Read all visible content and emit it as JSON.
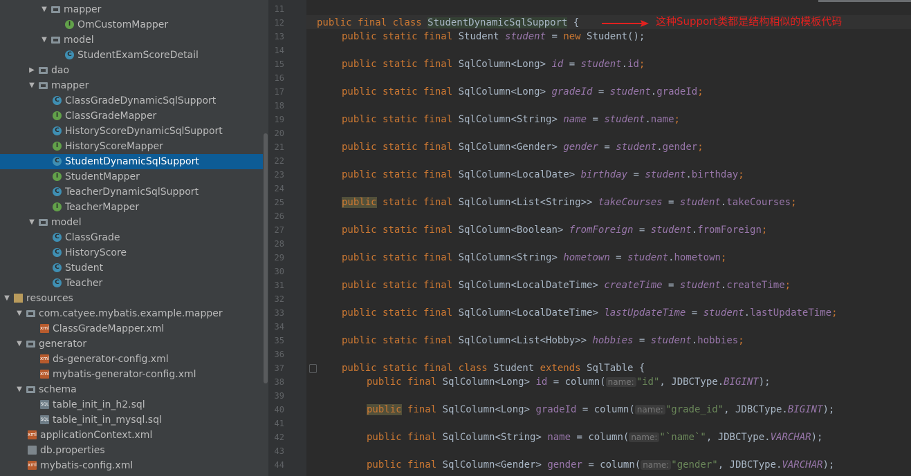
{
  "project_tree": {
    "items": [
      {
        "label": "mapper",
        "kind": "folder",
        "indent": 3,
        "expanded": true
      },
      {
        "label": "OmCustomMapper",
        "kind": "interface",
        "indent": 4
      },
      {
        "label": "model",
        "kind": "folder",
        "indent": 3,
        "expanded": true
      },
      {
        "label": "StudentExamScoreDetail",
        "kind": "class",
        "indent": 4
      },
      {
        "label": "dao",
        "kind": "folder",
        "indent": 2,
        "expanded": false
      },
      {
        "label": "mapper",
        "kind": "folder",
        "indent": 2,
        "expanded": true
      },
      {
        "label": "ClassGradeDynamicSqlSupport",
        "kind": "class",
        "indent": 3
      },
      {
        "label": "ClassGradeMapper",
        "kind": "interface",
        "indent": 3
      },
      {
        "label": "HistoryScoreDynamicSqlSupport",
        "kind": "class",
        "indent": 3
      },
      {
        "label": "HistoryScoreMapper",
        "kind": "interface",
        "indent": 3
      },
      {
        "label": "StudentDynamicSqlSupport",
        "kind": "class",
        "indent": 3,
        "selected": true
      },
      {
        "label": "StudentMapper",
        "kind": "interface",
        "indent": 3
      },
      {
        "label": "TeacherDynamicSqlSupport",
        "kind": "class",
        "indent": 3
      },
      {
        "label": "TeacherMapper",
        "kind": "interface",
        "indent": 3
      },
      {
        "label": "model",
        "kind": "folder",
        "indent": 2,
        "expanded": true
      },
      {
        "label": "ClassGrade",
        "kind": "class",
        "indent": 3
      },
      {
        "label": "HistoryScore",
        "kind": "class",
        "indent": 3
      },
      {
        "label": "Student",
        "kind": "class",
        "indent": 3
      },
      {
        "label": "Teacher",
        "kind": "class",
        "indent": 3
      },
      {
        "label": "resources",
        "kind": "resfolder",
        "indent": 0,
        "expanded": true
      },
      {
        "label": "com.catyee.mybatis.example.mapper",
        "kind": "folder",
        "indent": 1,
        "expanded": true
      },
      {
        "label": "ClassGradeMapper.xml",
        "kind": "xml",
        "indent": 2
      },
      {
        "label": "generator",
        "kind": "folder",
        "indent": 1,
        "expanded": true
      },
      {
        "label": "ds-generator-config.xml",
        "kind": "xml",
        "indent": 2
      },
      {
        "label": "mybatis-generator-config.xml",
        "kind": "xml",
        "indent": 2
      },
      {
        "label": "schema",
        "kind": "folder",
        "indent": 1,
        "expanded": true
      },
      {
        "label": "table_init_in_h2.sql",
        "kind": "sql",
        "indent": 2
      },
      {
        "label": "table_init_in_mysql.sql",
        "kind": "sql",
        "indent": 2
      },
      {
        "label": "applicationContext.xml",
        "kind": "xml",
        "indent": 1
      },
      {
        "label": "db.properties",
        "kind": "props",
        "indent": 1
      },
      {
        "label": "mybatis-config.xml",
        "kind": "xml",
        "indent": 1
      }
    ]
  },
  "editor": {
    "line_numbers": [
      "11",
      "12",
      "13",
      "14",
      "15",
      "16",
      "17",
      "18",
      "19",
      "20",
      "21",
      "22",
      "23",
      "24",
      "25",
      "26",
      "27",
      "28",
      "29",
      "30",
      "31",
      "32",
      "33",
      "34",
      "35",
      "36",
      "37",
      "38",
      "39",
      "40",
      "41",
      "42",
      "43",
      "44"
    ],
    "class_keywords": "public final class",
    "class_name": "StudentDynamicSqlSupport",
    "class_brace": " {",
    "student_field_kw": "public static final",
    "student_field_type": " Student ",
    "student_field_name": "student",
    "student_field_eq": " = ",
    "student_field_new": "new",
    "student_field_ctor": " Student();",
    "column_kw": "public static final",
    "columns": [
      {
        "type": " SqlColumn<Long> ",
        "name": "id",
        "ref": "id"
      },
      {
        "type": " SqlColumn<Long> ",
        "name": "gradeId",
        "ref": "gradeId"
      },
      {
        "type": " SqlColumn<String> ",
        "name": "name",
        "ref": "name"
      },
      {
        "type": " SqlColumn<Gender> ",
        "name": "gender",
        "ref": "gender"
      },
      {
        "type": " SqlColumn<LocalDate> ",
        "name": "birthday",
        "ref": "birthday"
      },
      {
        "type": " SqlColumn<List<String>> ",
        "name": "takeCourses",
        "ref": "takeCourses"
      },
      {
        "type": " SqlColumn<Boolean> ",
        "name": "fromForeign",
        "ref": "fromForeign"
      },
      {
        "type": " SqlColumn<String> ",
        "name": "hometown",
        "ref": "hometown"
      },
      {
        "type": " SqlColumn<LocalDateTime> ",
        "name": "createTime",
        "ref": "createTime"
      },
      {
        "type": " SqlColumn<LocalDateTime> ",
        "name": "lastUpdateTime",
        "ref": "lastUpdateTime"
      },
      {
        "type": " SqlColumn<List<Hobby>> ",
        "name": "hobbies",
        "ref": "hobbies"
      }
    ],
    "inner_class_kw": "public static final class",
    "inner_class_name": " Student ",
    "inner_class_extends": "extends",
    "inner_class_base": " SqlTable {",
    "inner_kw": "public final",
    "inner_columns": [
      {
        "type": " SqlColumn<Long> ",
        "name": "id",
        "hint": "name:",
        "value": "\"id\"",
        "jdbc": "BIGINT"
      },
      {
        "type": " SqlColumn<Long> ",
        "name": "gradeId",
        "hint": "name:",
        "value": "\"grade_id\"",
        "jdbc": "BIGINT"
      },
      {
        "type": " SqlColumn<String> ",
        "name": "name",
        "hint": "name:",
        "value": "\"`name`\"",
        "jdbc": "VARCHAR"
      },
      {
        "type": " SqlColumn<Gender> ",
        "name": "gender",
        "hint": "name:",
        "value": "\"gender\"",
        "jdbc": "VARCHAR"
      }
    ],
    "inner_column_call": " = column(",
    "jdbc_prefix": ", JDBCType.",
    "call_end": ");"
  },
  "annotation": {
    "text": "这种Support类都是结构相似的模板代码",
    "color": "#e0211f"
  }
}
